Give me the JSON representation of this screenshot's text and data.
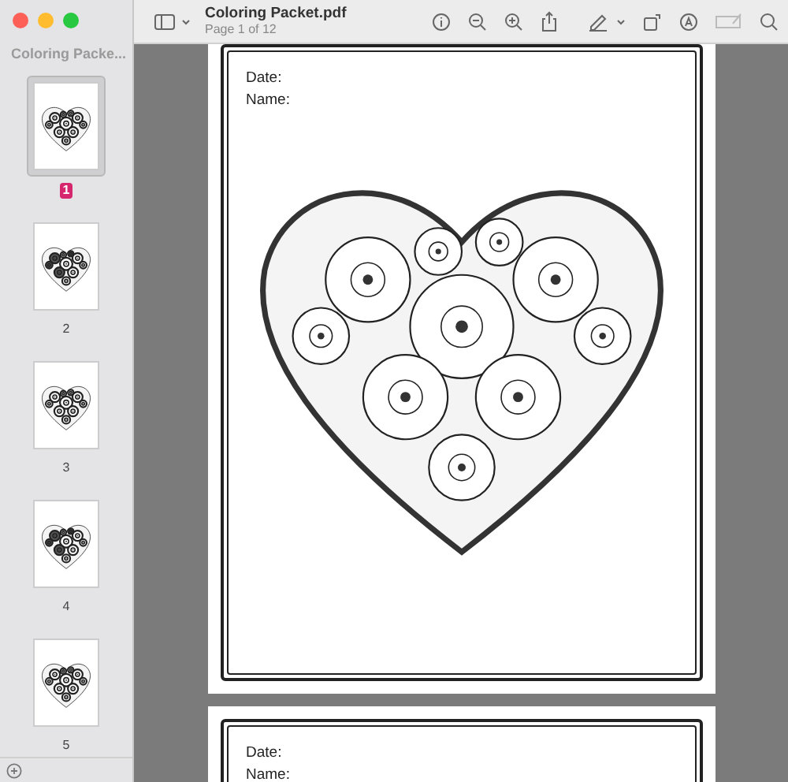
{
  "window": {
    "title": "Coloring Packet.pdf",
    "subtitle": "Page 1 of 12"
  },
  "sidebar": {
    "title": "Coloring Packe...",
    "pages": [
      {
        "label": "1",
        "selected": true
      },
      {
        "label": "2",
        "selected": false
      },
      {
        "label": "3",
        "selected": false
      },
      {
        "label": "4",
        "selected": false
      },
      {
        "label": "5",
        "selected": false
      }
    ]
  },
  "document": {
    "pages": [
      {
        "fields": [
          "Date:",
          "Name:"
        ]
      },
      {
        "fields": [
          "Date:",
          "Name:"
        ]
      }
    ]
  }
}
